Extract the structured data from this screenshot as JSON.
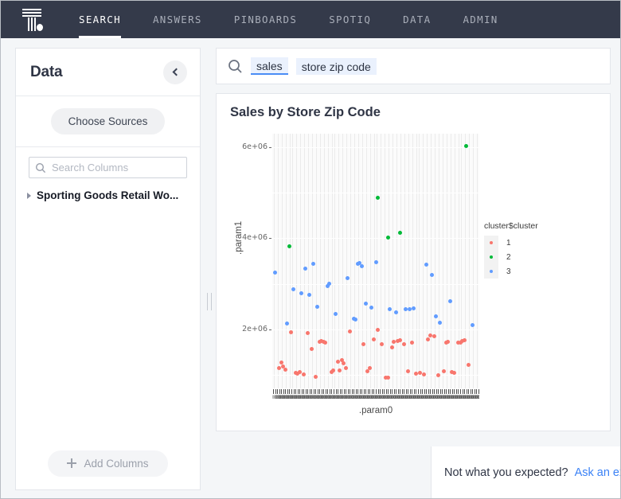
{
  "nav": {
    "logo_icon": "thoughtspot-logo-icon",
    "items": [
      {
        "label": "SEARCH",
        "active": true
      },
      {
        "label": "ANSWERS",
        "active": false
      },
      {
        "label": "PINBOARDS",
        "active": false
      },
      {
        "label": "SPOTIQ",
        "active": false
      },
      {
        "label": "DATA",
        "active": false
      },
      {
        "label": "ADMIN",
        "active": false
      }
    ]
  },
  "sidebar": {
    "title": "Data",
    "collapse_icon": "chevron-left-icon",
    "choose_sources_label": "Choose Sources",
    "search": {
      "icon": "search-icon",
      "placeholder": "Search Columns",
      "value": ""
    },
    "tree": [
      {
        "label": "Sporting Goods Retail Wo...",
        "caret_icon": "caret-right-icon"
      }
    ],
    "add_columns_label": "Add Columns",
    "add_columns_icon": "plus-icon"
  },
  "splitter": {
    "name": "panel-resize-handle"
  },
  "search": {
    "icon": "search-icon",
    "tokens": [
      {
        "text": "sales",
        "active": true
      },
      {
        "text": "store zip code",
        "active": false
      }
    ]
  },
  "result": {
    "title": "Sales by Store Zip Code"
  },
  "footer": {
    "text": "Not what you expected?",
    "link": "Ask an expert"
  },
  "colors": {
    "nav_bg": "#343a4a",
    "accent": "#3b82f6",
    "cluster_1": "#f8766d",
    "cluster_2": "#00ba38",
    "cluster_3": "#619cff",
    "panel_bg": "#ebebeb"
  },
  "chart_data": {
    "type": "scatter",
    "title": "Sales by Store Zip Code",
    "xlabel": ".param0",
    "ylabel": ".param1",
    "ylim": [
      700000,
      6300000
    ],
    "yticks": [
      2000000,
      4000000,
      6000000
    ],
    "ytick_labels": [
      "2e+06",
      "4e+06",
      "6e+06"
    ],
    "x_axis_type": "categorical-zip-codes",
    "x_tick_count": 103,
    "x_tick_labels_legible": false,
    "grid": true,
    "legend": {
      "title": "cluster$cluster",
      "position": "right",
      "entries": [
        {
          "label": "1",
          "color": "#f8766d"
        },
        {
          "label": "2",
          "color": "#00ba38"
        },
        {
          "label": "3",
          "color": "#619cff"
        }
      ]
    },
    "series": [
      {
        "name": "1",
        "color": "#f8766d",
        "points": [
          [
            3,
            1150000
          ],
          [
            4,
            1270000
          ],
          [
            5,
            1190000
          ],
          [
            6,
            1120000
          ],
          [
            9,
            1930000
          ],
          [
            11,
            1040000
          ],
          [
            12,
            1020000
          ],
          [
            13,
            1060000
          ],
          [
            15,
            1010000
          ],
          [
            17,
            1910000
          ],
          [
            19,
            1560000
          ],
          [
            21,
            950000
          ],
          [
            23,
            1720000
          ],
          [
            24,
            1740000
          ],
          [
            25,
            1730000
          ],
          [
            26,
            1700000
          ],
          [
            29,
            1060000
          ],
          [
            30,
            1090000
          ],
          [
            32,
            1290000
          ],
          [
            33,
            1100000
          ],
          [
            34,
            1330000
          ],
          [
            35,
            1260000
          ],
          [
            36,
            1150000
          ],
          [
            38,
            1960000
          ],
          [
            45,
            1680000
          ],
          [
            47,
            1080000
          ],
          [
            48,
            1140000
          ],
          [
            50,
            1770000
          ],
          [
            52,
            1990000
          ],
          [
            54,
            1670000
          ],
          [
            56,
            940000
          ],
          [
            57,
            940000
          ],
          [
            59,
            1610000
          ],
          [
            60,
            1730000
          ],
          [
            62,
            1750000
          ],
          [
            63,
            1760000
          ],
          [
            65,
            1680000
          ],
          [
            67,
            1070000
          ],
          [
            69,
            1700000
          ],
          [
            71,
            1030000
          ],
          [
            73,
            1040000
          ],
          [
            75,
            1010000
          ],
          [
            77,
            1780000
          ],
          [
            78,
            1860000
          ],
          [
            80,
            1840000
          ],
          [
            82,
            990000
          ],
          [
            85,
            1070000
          ],
          [
            86,
            1700000
          ],
          [
            87,
            1730000
          ],
          [
            89,
            1060000
          ],
          [
            90,
            1040000
          ],
          [
            92,
            1700000
          ],
          [
            93,
            1710000
          ],
          [
            94,
            1750000
          ],
          [
            95,
            1760000
          ],
          [
            97,
            1220000
          ]
        ]
      },
      {
        "name": "2",
        "color": "#00ba38",
        "points": [
          [
            8,
            3830000
          ],
          [
            52,
            4890000
          ],
          [
            57,
            4020000
          ],
          [
            63,
            4120000
          ],
          [
            96,
            6030000
          ]
        ]
      },
      {
        "name": "3",
        "color": "#619cff",
        "points": [
          [
            1,
            3250000
          ],
          [
            7,
            2120000
          ],
          [
            10,
            2880000
          ],
          [
            14,
            2800000
          ],
          [
            16,
            3330000
          ],
          [
            18,
            2760000
          ],
          [
            20,
            3440000
          ],
          [
            22,
            2500000
          ],
          [
            27,
            2950000
          ],
          [
            28,
            3010000
          ],
          [
            31,
            2340000
          ],
          [
            37,
            3130000
          ],
          [
            40,
            2230000
          ],
          [
            41,
            2210000
          ],
          [
            42,
            3440000
          ],
          [
            43,
            3450000
          ],
          [
            44,
            3390000
          ],
          [
            46,
            2570000
          ],
          [
            49,
            2480000
          ],
          [
            51,
            3480000
          ],
          [
            58,
            2450000
          ],
          [
            61,
            2380000
          ],
          [
            66,
            2440000
          ],
          [
            68,
            2440000
          ],
          [
            70,
            2460000
          ],
          [
            76,
            3430000
          ],
          [
            79,
            3190000
          ],
          [
            81,
            2280000
          ],
          [
            83,
            2140000
          ],
          [
            88,
            2620000
          ],
          [
            99,
            2090000
          ]
        ]
      }
    ]
  }
}
